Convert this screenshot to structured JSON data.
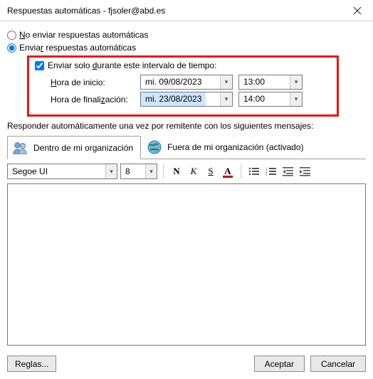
{
  "title": "Respuestas automáticas - fjsoler@abd.es",
  "radio_no": "No enviar respuestas automáticas",
  "radio_no_u": "N",
  "radio_yes": "Enviar respuestas automáticas",
  "radio_yes_u": "r",
  "chk_label_pre": "Enviar solo ",
  "chk_label_u": "d",
  "chk_label_post": "urante este intervalo de tiempo:",
  "start_label_u": "H",
  "start_label": "ora de inicio:",
  "end_label_pre": "Hora de finali",
  "end_label_u": "z",
  "end_label_post": "ación:",
  "start_date": "mi. 09/08/2023",
  "start_time": "13:00",
  "end_date": "mi. 23/08/2023",
  "end_time": "14:00",
  "desc": "Responder automáticamente una vez por remitente con los siguientes mensajes:",
  "tab_inside": "Dentro de mi organización",
  "tab_outside": "Fuera de mi organización (activado)",
  "font_family": "Segoe UI",
  "font_size": "8",
  "rules_btn": "Reglas...",
  "rules_u": "g",
  "ok_btn": "Aceptar",
  "cancel_btn": "Cancelar"
}
